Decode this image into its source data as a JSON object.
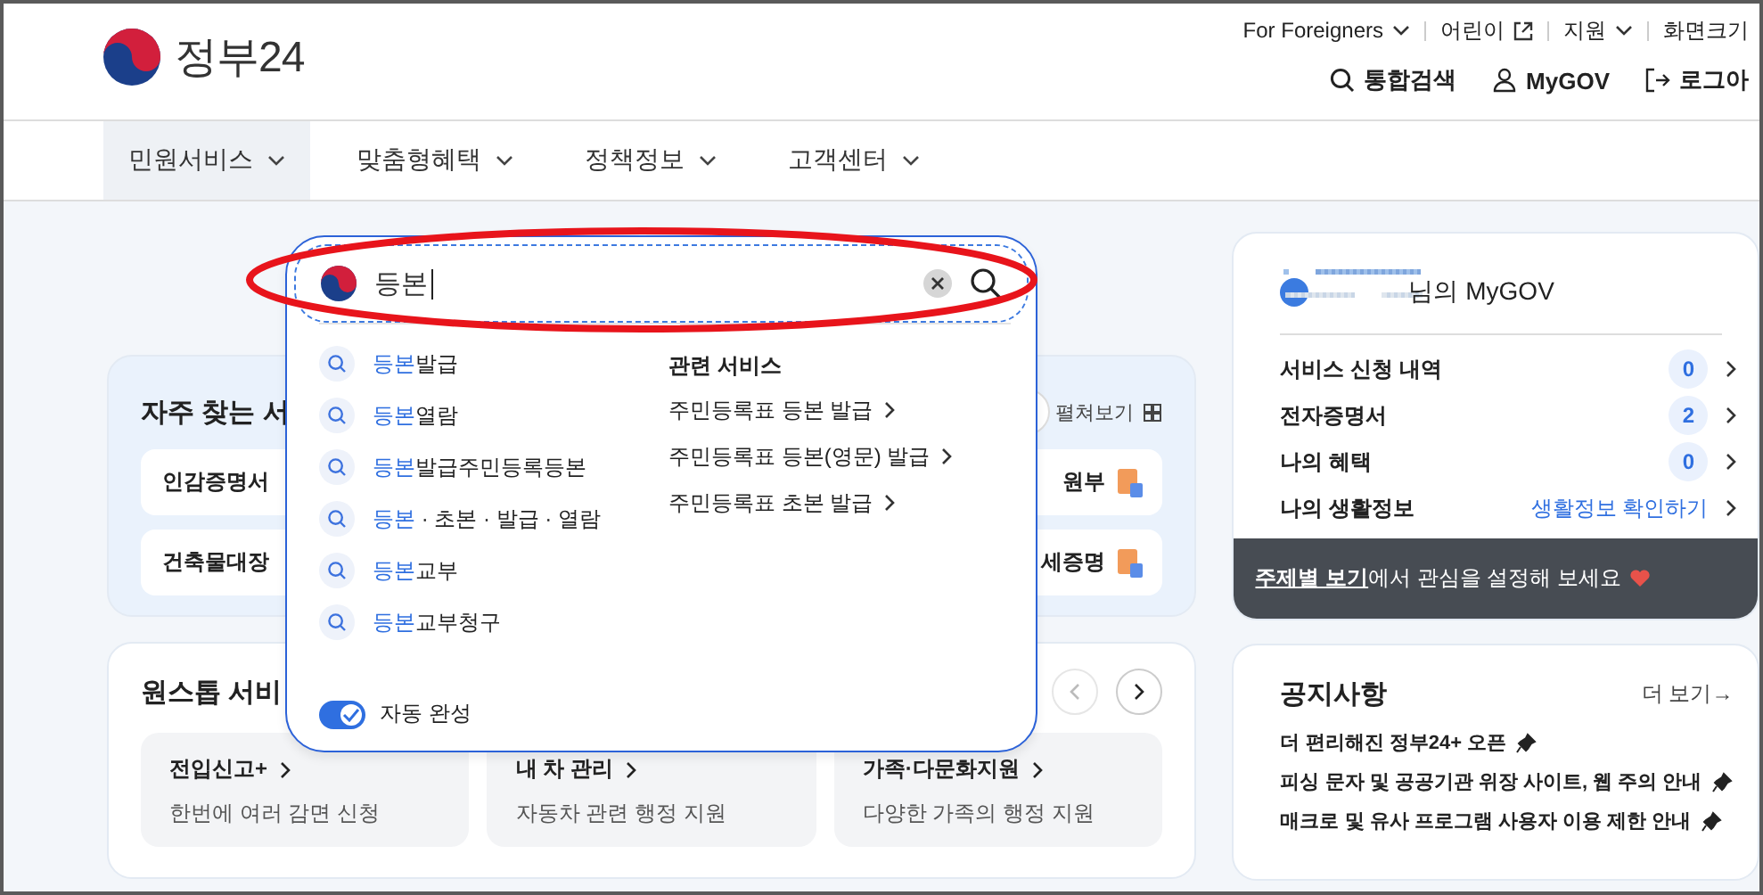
{
  "header": {
    "logo_text": "정부24",
    "utility_links": [
      "For Foreigners",
      "어린이",
      "지원",
      "화면크기"
    ],
    "actions": [
      "통합검색",
      "MyGOV",
      "로그아"
    ]
  },
  "nav": [
    {
      "label": "민원서비스",
      "selected": true
    },
    {
      "label": "맞춤형혜택",
      "selected": false
    },
    {
      "label": "정책정보",
      "selected": false
    },
    {
      "label": "고객센터",
      "selected": false
    }
  ],
  "frequent_services": {
    "title": "자주 찾는 서",
    "expand_label": "펼쳐보기",
    "rows": [
      {
        "left": "인감증명서",
        "right": "원부"
      },
      {
        "left": "건축물대장",
        "right": "세증명"
      }
    ]
  },
  "onestop_services": {
    "title": "원스톱 서비",
    "cards": [
      {
        "title": "전입신고+",
        "desc": "한번에 여러 감면 신청"
      },
      {
        "title": "내 차 관리",
        "desc": "자동차 관련 행정 지원"
      },
      {
        "title": "가족·다문화지원",
        "desc": "다양한 가족의 행정 지원"
      }
    ]
  },
  "mygov": {
    "title": "님의 MyGOV",
    "rows": [
      {
        "kind": "count",
        "label": "서비스 신청 내역",
        "value": "0"
      },
      {
        "kind": "count",
        "label": "전자증명서",
        "value": "2"
      },
      {
        "kind": "count",
        "label": "나의 혜택",
        "value": "0"
      },
      {
        "kind": "link",
        "label": "나의 생활정보",
        "value": "생활정보 확인하기"
      }
    ],
    "banner": {
      "link": "주제별 보기",
      "text": "에서 관심을 설정해 보세요"
    }
  },
  "notices": {
    "title": "공지사항",
    "more": "더 보기→",
    "items": [
      "더 편리해진 정부24+ 오픈",
      "피싱 문자 및 공공기관 위장 사이트, 웹 주의 안내",
      "매크로 및 유사 프로그램 사용자 이용 제한 안내"
    ]
  },
  "search_popup": {
    "value": "등본",
    "suggestions": [
      {
        "match": "등본",
        "rest": "발급"
      },
      {
        "match": "등본",
        "rest": "열람"
      },
      {
        "match": "등본",
        "rest": "발급주민등록등본"
      },
      {
        "match": "등본",
        "rest": " · 초본 · 발급 · 열람"
      },
      {
        "match": "등본",
        "rest": "교부"
      },
      {
        "match": "등본",
        "rest": "교부청구"
      }
    ],
    "related_title": "관련 서비스",
    "related": [
      "주민등록표 등본 발급",
      "주민등록표 등본(영문) 발급",
      "주민등록표 초본 발급"
    ],
    "autocomplete": {
      "label": "자동 완성",
      "on": true
    }
  }
}
